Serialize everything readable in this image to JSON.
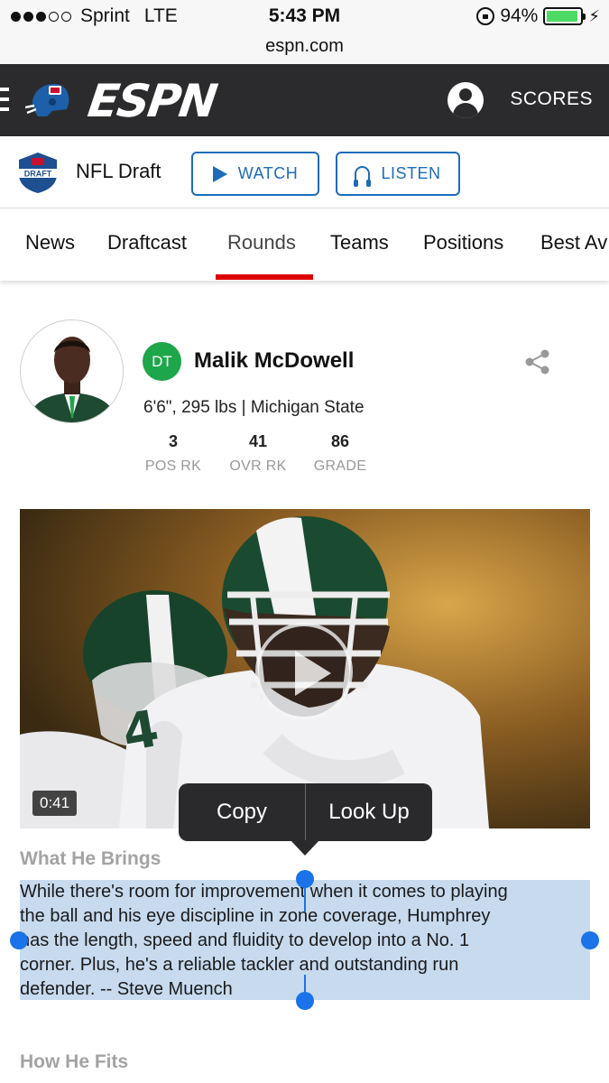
{
  "status_bar": {
    "carrier": "Sprint",
    "network": "LTE",
    "time": "5:43 PM",
    "battery": "94%",
    "battery_level": 0.94
  },
  "browser": {
    "url": "espn.com"
  },
  "header": {
    "logo_text": "ESPN",
    "scores_label": "SCORES"
  },
  "draft_bar": {
    "title": "NFL Draft",
    "watch_label": "WATCH",
    "listen_label": "LISTEN",
    "logo_text": "DRAFT"
  },
  "tabs": [
    {
      "label": "News"
    },
    {
      "label": "Draftcast"
    },
    {
      "label": "Rounds",
      "active": true
    },
    {
      "label": "Teams"
    },
    {
      "label": "Positions"
    },
    {
      "label": "Best Av"
    }
  ],
  "player": {
    "position": "DT",
    "name": "Malik McDowell",
    "info": "6'6\", 295 lbs | Michigan State",
    "stats": [
      {
        "value": "3",
        "label": "POS RK"
      },
      {
        "value": "41",
        "label": "OVR RK"
      },
      {
        "value": "86",
        "label": "GRADE"
      }
    ]
  },
  "video": {
    "duration": "0:41"
  },
  "context_menu": {
    "copy": "Copy",
    "look_up": "Look Up"
  },
  "sections": {
    "what_he_brings_title": "What He Brings",
    "what_he_brings_text": "While there's room for improvement when it comes to playing\nthe ball and his eye discipline in zone coverage, Humphrey\nhas the length, speed and fluidity to develop into a No. 1\ncorner. Plus, he's a reliable tackler and outstanding run\ndefender. -- Steve Muench",
    "how_he_fits_title": "How He Fits"
  },
  "colors": {
    "header_bg": "#2b2b2d",
    "accent_blue": "#1c6cba",
    "tab_underline": "#dd0000",
    "position_badge": "#1ea64a",
    "selection": "#c7daee",
    "selection_handle": "#1a73e8"
  }
}
